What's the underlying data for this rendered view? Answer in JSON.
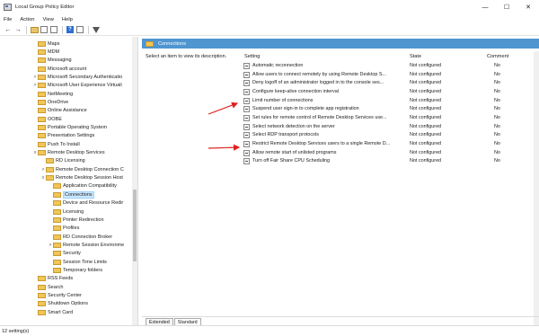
{
  "window": {
    "title": "Local Group Policy Editor",
    "minimize_glyph": "—",
    "maximize_glyph": "☐",
    "close_glyph": "✕"
  },
  "menu": [
    "File",
    "Action",
    "View",
    "Help"
  ],
  "tree": [
    {
      "label": "Maps",
      "level": 3,
      "expander": ""
    },
    {
      "label": "MDM",
      "level": 3,
      "expander": ""
    },
    {
      "label": "Messaging",
      "level": 3,
      "expander": ""
    },
    {
      "label": "Microsoft account",
      "level": 3,
      "expander": ""
    },
    {
      "label": "Microsoft Secondary Authenticatio",
      "level": 3,
      "expander": ">"
    },
    {
      "label": "Microsoft User Experience Virtuali",
      "level": 3,
      "expander": ">"
    },
    {
      "label": "NetMeeting",
      "level": 3,
      "expander": ""
    },
    {
      "label": "OneDrive",
      "level": 3,
      "expander": ""
    },
    {
      "label": "Online Assistance",
      "level": 3,
      "expander": ""
    },
    {
      "label": "OOBE",
      "level": 3,
      "expander": ""
    },
    {
      "label": "Portable Operating System",
      "level": 3,
      "expander": ""
    },
    {
      "label": "Presentation Settings",
      "level": 3,
      "expander": ""
    },
    {
      "label": "Push To Install",
      "level": 3,
      "expander": ""
    },
    {
      "label": "Remote Desktop Services",
      "level": 3,
      "expander": "v"
    },
    {
      "label": "RD Licensing",
      "level": 4,
      "expander": ""
    },
    {
      "label": "Remote Desktop Connection C",
      "level": 4,
      "expander": ">"
    },
    {
      "label": "Remote Desktop Session Host",
      "level": 4,
      "expander": "v"
    },
    {
      "label": "Application Compatibility",
      "level": 5,
      "expander": ""
    },
    {
      "label": "Connections",
      "level": 5,
      "expander": "",
      "selected": true
    },
    {
      "label": "Device and Resource Redir",
      "level": 5,
      "expander": ""
    },
    {
      "label": "Licensing",
      "level": 5,
      "expander": ""
    },
    {
      "label": "Printer Redirection",
      "level": 5,
      "expander": ""
    },
    {
      "label": "Profiles",
      "level": 5,
      "expander": ""
    },
    {
      "label": "RD Connection Broker",
      "level": 5,
      "expander": ""
    },
    {
      "label": "Remote Session Environme",
      "level": 5,
      "expander": ">"
    },
    {
      "label": "Security",
      "level": 5,
      "expander": ""
    },
    {
      "label": "Session Time Limits",
      "level": 5,
      "expander": ""
    },
    {
      "label": "Temporary folders",
      "level": 5,
      "expander": ""
    },
    {
      "label": "RSS Feeds",
      "level": 3,
      "expander": ""
    },
    {
      "label": "Search",
      "level": 3,
      "expander": ""
    },
    {
      "label": "Security Center",
      "level": 3,
      "expander": ""
    },
    {
      "label": "Shutdown Options",
      "level": 3,
      "expander": ""
    },
    {
      "label": "Smart Card",
      "level": 3,
      "expander": ""
    }
  ],
  "panel": {
    "title": "Connections",
    "description": "Select an item to view its description."
  },
  "columns": {
    "setting": "Setting",
    "state": "State",
    "comment": "Comment"
  },
  "settings": [
    {
      "name": "Automatic reconnection",
      "state": "Not configured",
      "comment": "No"
    },
    {
      "name": "Allow users to connect remotely by using Remote Desktop S...",
      "state": "Not configured",
      "comment": "No"
    },
    {
      "name": "Deny logoff of an administrator logged in to the console ses...",
      "state": "Not configured",
      "comment": "No"
    },
    {
      "name": "Configure keep-alive connection interval",
      "state": "Not configured",
      "comment": "No"
    },
    {
      "name": "Limit number of connections",
      "state": "Not configured",
      "comment": "No"
    },
    {
      "name": "Suspend user sign-in to complete app registration",
      "state": "Not configured",
      "comment": "No"
    },
    {
      "name": "Set rules for remote control of Remote Desktop Services use...",
      "state": "Not configured",
      "comment": "No"
    },
    {
      "name": "Select network detection on the server",
      "state": "Not configured",
      "comment": "No"
    },
    {
      "name": "Select RDP transport protocols",
      "state": "Not configured",
      "comment": "No"
    },
    {
      "name": "Restrict Remote Desktop Services users to a single Remote D...",
      "state": "Not configured",
      "comment": "No"
    },
    {
      "name": "Allow remote start of unlisted programs",
      "state": "Not configured",
      "comment": "No"
    },
    {
      "name": "Turn off Fair Share CPU Scheduling",
      "state": "Not configured",
      "comment": "No"
    }
  ],
  "tabs": [
    "Extended",
    "Standard"
  ],
  "status": "12 setting(s)",
  "colors": {
    "accent": "#4f95d0",
    "annotation": "#e02020"
  }
}
